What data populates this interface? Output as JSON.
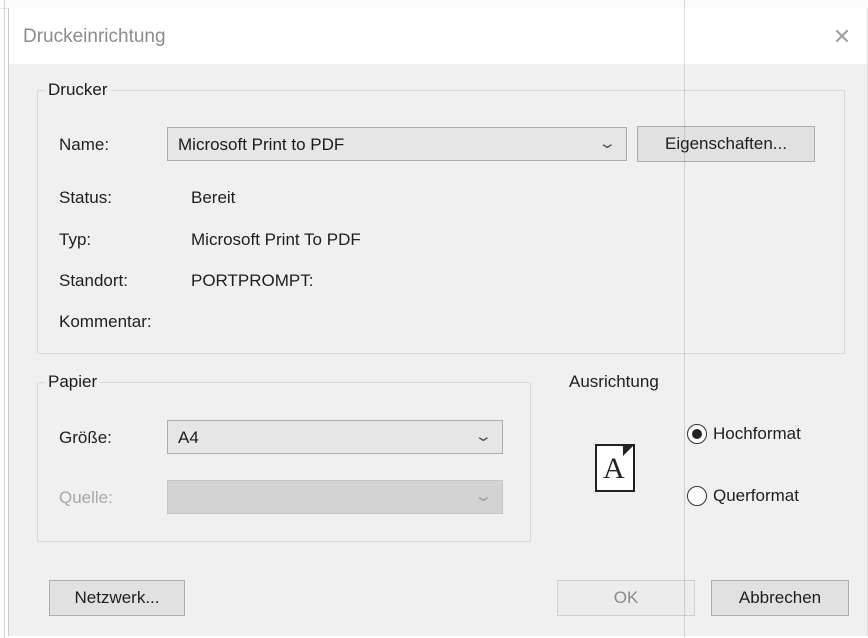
{
  "dialog": {
    "title": "Druckeinrichtung",
    "close_glyph": "✕"
  },
  "printer": {
    "group_label": "Drucker",
    "name_label": "Name:",
    "name_value": "Microsoft Print to PDF",
    "properties_button": "Eigenschaften...",
    "status_label": "Status:",
    "status_value": "Bereit",
    "type_label": "Typ:",
    "type_value": "Microsoft Print To PDF",
    "location_label": "Standort:",
    "location_value": "PORTPROMPT:",
    "comment_label": "Kommentar:",
    "comment_value": ""
  },
  "paper": {
    "group_label": "Papier",
    "size_label": "Größe:",
    "size_value": "A4",
    "source_label": "Quelle:",
    "source_value": ""
  },
  "orientation": {
    "group_label": "Ausrichtung",
    "icon_letter": "A",
    "portrait_label": "Hochformat",
    "landscape_label": "Querformat",
    "selected": "portrait"
  },
  "buttons": {
    "network": "Netzwerk...",
    "ok": "OK",
    "cancel": "Abbrechen"
  },
  "icons": {
    "dropdown": "chevron-down-icon",
    "close": "close-icon"
  }
}
